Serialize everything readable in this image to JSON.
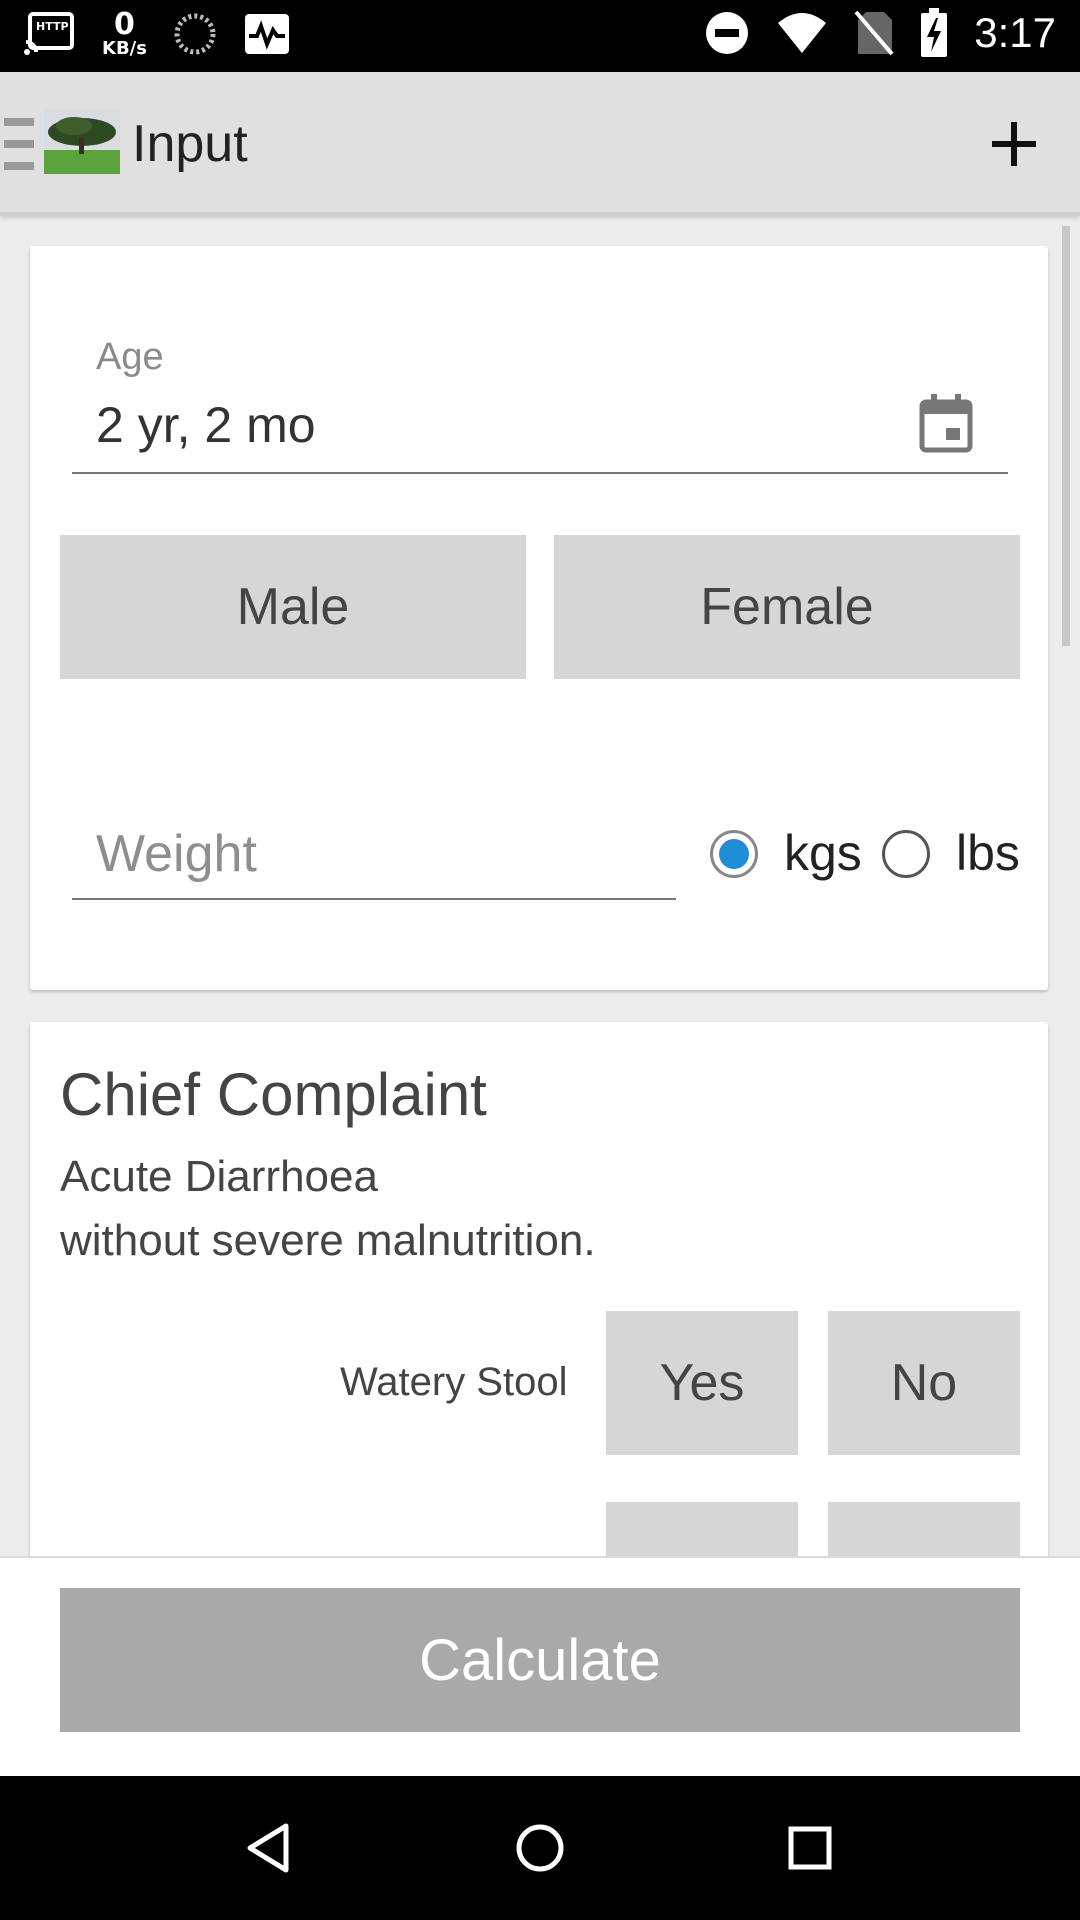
{
  "status_bar": {
    "net_speed_value": "0",
    "net_speed_unit": "KB/s",
    "time": "3:17",
    "icons": [
      "cast-http-icon",
      "net-speed-indicator",
      "sync-circle-icon",
      "activity-icon",
      "do-not-disturb-icon",
      "wifi-icon",
      "no-sim-icon",
      "battery-charging-icon"
    ]
  },
  "toolbar": {
    "title": "Input",
    "icons": [
      "drawer-menu-icon",
      "tree-logo",
      "plus-icon"
    ]
  },
  "form": {
    "age": {
      "label": "Age",
      "value": "2 yr, 2 mo",
      "icon": "calendar-icon"
    },
    "sex": {
      "male_label": "Male",
      "female_label": "Female"
    },
    "weight": {
      "placeholder": "Weight",
      "units": [
        {
          "label": "kgs",
          "selected": true
        },
        {
          "label": "lbs",
          "selected": false
        }
      ],
      "accent_color": "#1e8fd6"
    }
  },
  "chief_complaint": {
    "title": "Chief Complaint",
    "line1": "Acute Diarrhoea",
    "line2": "without severe malnutrition.",
    "questions": [
      {
        "label": "Watery Stool",
        "yes": "Yes",
        "no": "No"
      }
    ]
  },
  "footer": {
    "calculate_label": "Calculate"
  },
  "nav_bar": {
    "icons": [
      "back-icon",
      "home-icon",
      "recents-icon"
    ]
  }
}
